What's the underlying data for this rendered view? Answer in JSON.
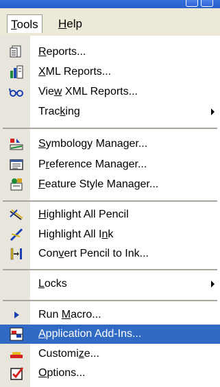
{
  "menubar": {
    "items": [
      {
        "label": "Tools",
        "mnemonic": "T",
        "rest": "ools",
        "active": true
      },
      {
        "label": "Help",
        "mnemonic": "H",
        "rest": "elp",
        "active": false
      }
    ]
  },
  "menu": {
    "items": [
      {
        "id": "reports",
        "pre": "",
        "key": "R",
        "post": "eports...",
        "icon": "report-icon"
      },
      {
        "id": "xml-reports",
        "pre": "",
        "key": "X",
        "post": "ML Reports...",
        "icon": "xml-report-icon"
      },
      {
        "id": "view-xml-reports",
        "pre": "Vie",
        "key": "w",
        "post": " XML Reports...",
        "icon": "glasses-icon"
      },
      {
        "id": "tracking",
        "pre": "Trac",
        "key": "k",
        "post": "ing",
        "icon": "",
        "submenu": true
      },
      {
        "id": "symbology-manager",
        "pre": "",
        "key": "S",
        "post": "ymbology Manager...",
        "icon": "symbology-icon"
      },
      {
        "id": "preference-manager",
        "pre": "P",
        "key": "r",
        "post": "eference Manager...",
        "icon": "preferences-icon"
      },
      {
        "id": "feature-style-manager",
        "pre": "",
        "key": "F",
        "post": "eature Style Manager...",
        "icon": "feature-style-icon"
      },
      {
        "id": "highlight-all-pencil",
        "pre": "",
        "key": "H",
        "post": "ighlight All Pencil",
        "icon": "pencil-icon"
      },
      {
        "id": "highlight-all-ink",
        "pre": "Highlight All I",
        "key": "n",
        "post": "k",
        "icon": "ink-pen-icon"
      },
      {
        "id": "convert-pencil-to-ink",
        "pre": "Con",
        "key": "v",
        "post": "ert Pencil to Ink...",
        "icon": "convert-icon"
      },
      {
        "id": "locks",
        "pre": "",
        "key": "L",
        "post": "ocks",
        "icon": "",
        "submenu": true
      },
      {
        "id": "run-macro",
        "pre": "Run ",
        "key": "M",
        "post": "acro...",
        "icon": "play-icon"
      },
      {
        "id": "application-add-ins",
        "pre": "",
        "key": "A",
        "post": "pplication Add-Ins...",
        "icon": "add-ins-icon",
        "selected": true
      },
      {
        "id": "customize",
        "pre": "Customi",
        "key": "z",
        "post": "e...",
        "icon": "customize-icon"
      },
      {
        "id": "options",
        "pre": "",
        "key": "O",
        "post": "ptions...",
        "icon": "checkbox-icon"
      }
    ]
  },
  "colors": {
    "menubar_bg": "#ece9d8",
    "gutter_bg": "#e8e6dc",
    "selection_bg": "#316ac5",
    "separator": "#a7a59c"
  }
}
